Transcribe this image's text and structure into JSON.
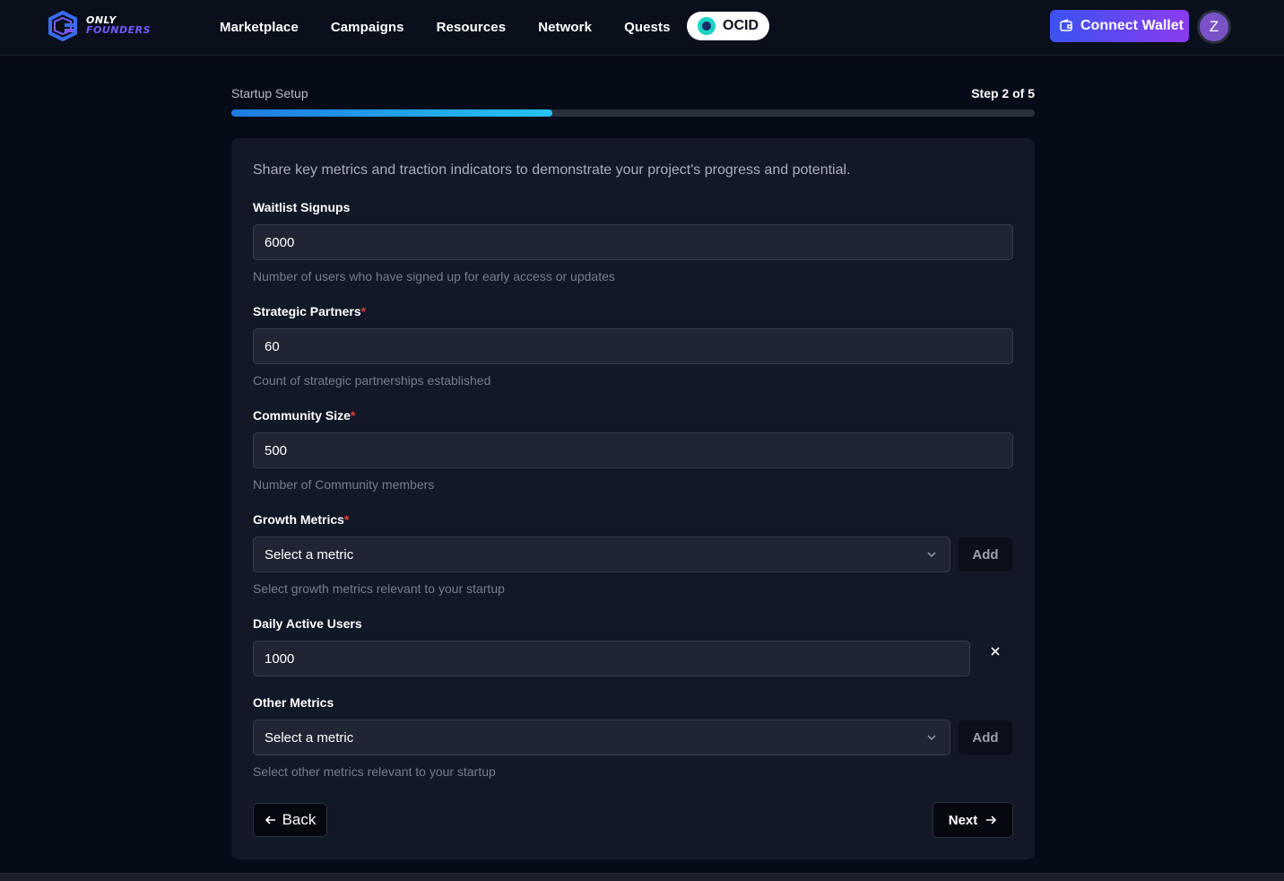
{
  "brand": {
    "line1": "ONLY",
    "line2": "FOUNDERS"
  },
  "nav": {
    "links": [
      "Marketplace",
      "Campaigns",
      "Resources",
      "Network",
      "Quests"
    ],
    "ocid_label": "OCID",
    "connect_wallet_label": "Connect Wallet",
    "avatar_initial": "Z"
  },
  "progress": {
    "title": "Startup Setup",
    "step_label": "Step 2 of 5",
    "fraction": 0.4
  },
  "form": {
    "intro": "Share key metrics and traction indicators to demonstrate your project's progress and potential.",
    "waitlist": {
      "label": "Waitlist Signups",
      "value": "6000",
      "hint": "Number of users who have signed up for early access or updates"
    },
    "partners": {
      "label": "Strategic Partners",
      "required_mark": "*",
      "value": "60",
      "hint": "Count of strategic partnerships established"
    },
    "community": {
      "label": "Community Size",
      "required_mark": "*",
      "value": "500",
      "hint": "Number of Community members"
    },
    "growth": {
      "label": "Growth Metrics",
      "required_mark": "*",
      "select_value": "Select a metric",
      "add_label": "Add",
      "hint": "Select growth metrics relevant to your startup"
    },
    "dau": {
      "label": "Daily Active Users",
      "value": "1000"
    },
    "other": {
      "label": "Other Metrics",
      "select_value": "Select a metric",
      "add_label": "Add",
      "hint": "Select other metrics relevant to your startup"
    },
    "back_label": "Back",
    "next_label": "Next"
  },
  "colors": {
    "accent_gradient_start": "#3b53f2",
    "accent_gradient_end": "#8b3bee",
    "progress_start": "#1f7ae0",
    "progress_end": "#26c2f2",
    "required": "#e03c3c"
  }
}
